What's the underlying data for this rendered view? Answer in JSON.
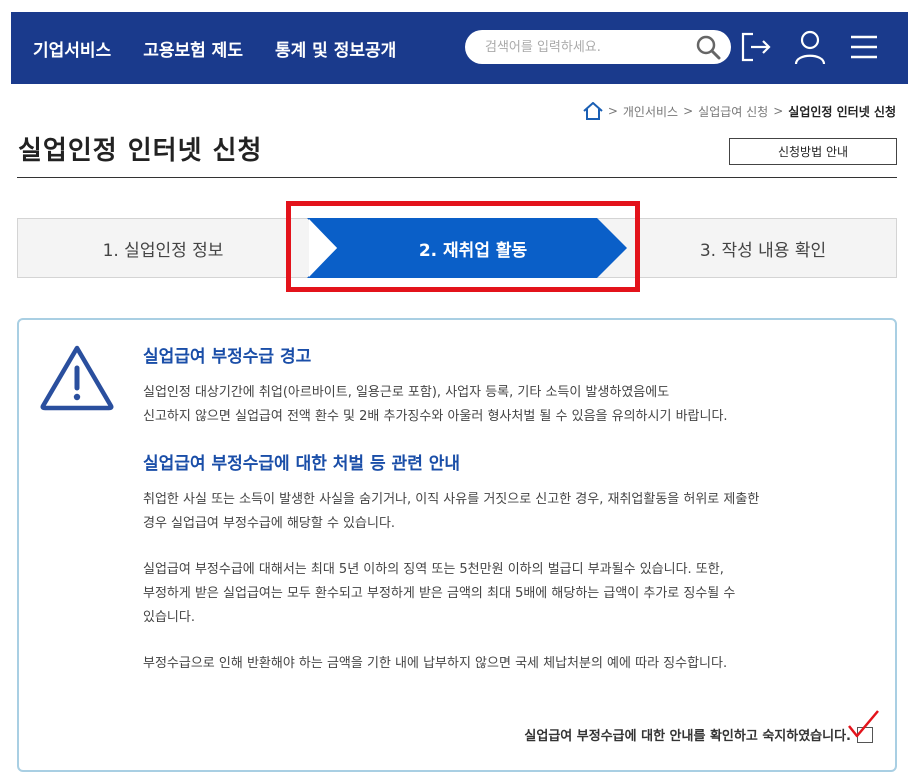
{
  "header": {
    "nav": [
      "기업서비스",
      "고용보험 제도",
      "통계 및 정보공개"
    ],
    "search_placeholder": "검색어를 입력하세요.",
    "brand_color": "#1a3a8c"
  },
  "breadcrumb": {
    "items": [
      "개인서비스",
      "실업급여 신청"
    ],
    "current": "실업인정 인터넷 신청"
  },
  "page": {
    "title": "실업인정 인터넷 신청",
    "guide_button": "신청방법 안내"
  },
  "steps": [
    {
      "label": "1. 실업인정 정보",
      "active": false
    },
    {
      "label": "2. 재취업 활동",
      "active": true
    },
    {
      "label": "3. 작성 내용 확인",
      "active": false
    }
  ],
  "notice": {
    "warning_title": "실업급여 부정수급 경고",
    "warning_lines": [
      "실업인정 대상기간에 취업(아르바이트, 일용근로 포함), 사업자 등록, 기타 소득이 발생하였음에도",
      "신고하지 않으면 실업급여 전액 환수 및 2배 추가징수와 아울러 형사처벌 될 수 있음을 유의하시기 바랍니다."
    ],
    "penalty_title": "실업급여 부정수급에 대한 처벌 등 관련 안내",
    "penalty_p1": [
      "취업한 사실 또는 소득이 발생한 사실을 숨기거나, 이직 사유를 거짓으로 신고한 경우, 재취업활동을 허위로 제출한",
      "경우 실업급여 부정수급에 해당할 수 있습니다."
    ],
    "penalty_p2": [
      "실업급여 부정수급에 대해서는 최대 5년 이하의 징역 또는 5천만원 이하의 벌급디 부과될수 있습니다. 또한,",
      "부정하게 받은 실업급여는 모두 환수되고 부정하게 받은 금액의 최대 5배에 해당하는 급액이 추가로 징수될 수",
      "있습니다."
    ],
    "penalty_p3": [
      "부정수급으로 인해 반환해야 하는 금액을 기한 내에 납부하지 않으면 국세 체납처분의 예에 따라 징수합니다."
    ],
    "agree_label": "실업급여 부정수급에 대한 안내를 확인하고 숙지하였습니다."
  },
  "colors": {
    "active_step": "#0a5fc8",
    "highlight": "#e3131b",
    "heading": "#1a4ea8"
  }
}
